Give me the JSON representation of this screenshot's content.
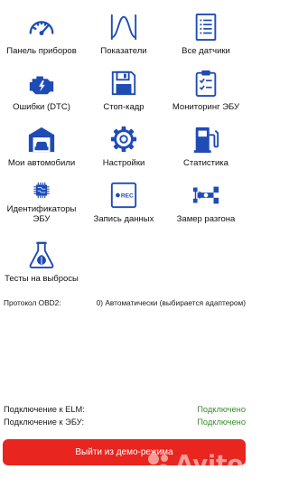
{
  "tiles": [
    {
      "label": "Панель приборов",
      "icon": "speedometer-icon"
    },
    {
      "label": "Показатели",
      "icon": "waveform-icon"
    },
    {
      "label": "Все датчики",
      "icon": "list-icon"
    },
    {
      "label": "Ошибки (DTC)",
      "icon": "engine-icon"
    },
    {
      "label": "Стоп-кадр",
      "icon": "floppy-disk-icon"
    },
    {
      "label": "Мониторинг ЭБУ",
      "icon": "clipboard-check-icon"
    },
    {
      "label": "Мои автомобили",
      "icon": "garage-icon"
    },
    {
      "label": "Настройки",
      "icon": "gear-icon"
    },
    {
      "label": "Статистика",
      "icon": "fuel-pump-icon"
    },
    {
      "label": "Идентификаторы\nЭБУ",
      "icon": "chip-icon"
    },
    {
      "label": "Запись данных",
      "icon": "rec-icon",
      "icon_text": "REC"
    },
    {
      "label": "Замер разгона",
      "icon": "race-car-icon"
    },
    {
      "label": "Тесты на выбросы",
      "icon": "flask-leaf-icon"
    }
  ],
  "protocol": {
    "label": "Протокол OBD2:",
    "value": "0) Автоматически (выбирается адаптером)"
  },
  "connections": [
    {
      "label": "Подключение к ELM:",
      "value": "Подключено"
    },
    {
      "label": "Подключение к ЭБУ:",
      "value": "Подключено"
    }
  ],
  "exit_button": {
    "label": "Выйти из демо-режима"
  },
  "watermark": {
    "text": "Avito"
  },
  "colors": {
    "icon": "#1f4bb5",
    "button": "#e8251f",
    "status_ok": "#3b8c2e"
  }
}
